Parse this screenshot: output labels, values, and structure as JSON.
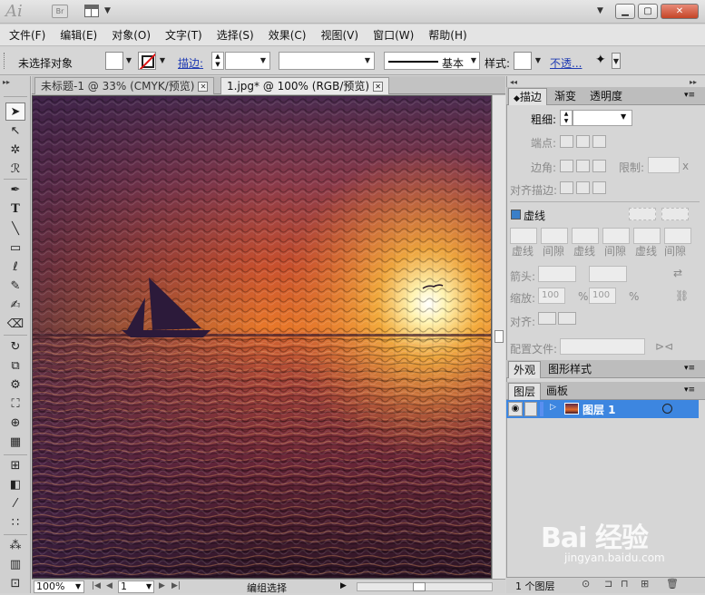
{
  "titlebar": {
    "app_logo": "Ai",
    "bridge_logo": "Br",
    "arrange_dropdown": "▼",
    "window_menu_arrow": "▼",
    "minimize": "▁",
    "restore": "▢",
    "close": "✕"
  },
  "menu": [
    {
      "label": "文件(F)"
    },
    {
      "label": "编辑(E)"
    },
    {
      "label": "对象(O)"
    },
    {
      "label": "文字(T)"
    },
    {
      "label": "选择(S)"
    },
    {
      "label": "效果(C)"
    },
    {
      "label": "视图(V)"
    },
    {
      "label": "窗口(W)"
    },
    {
      "label": "帮助(H)"
    }
  ],
  "controlbar": {
    "selection_status": "未选择对象",
    "stroke_label": "描边:",
    "stroke_profile": "基本",
    "style_label": "样式:",
    "opacity_label": "不透..."
  },
  "tabs": [
    {
      "label": "未标题-1 @ 33% (CMYK/预览)",
      "active": false
    },
    {
      "label": "1.jpg* @ 100% (RGB/预览)",
      "active": true
    }
  ],
  "statusbar": {
    "zoom": "100%",
    "artboard": "1",
    "mode": "编组选择"
  },
  "stroke_panel": {
    "tabs": [
      "描边",
      "渐变",
      "透明度"
    ],
    "weight_label": "粗细:",
    "cap_label": "端点:",
    "corner_label": "边角:",
    "limit_label": "限制:",
    "limit_unit": "x",
    "align_label": "对齐描边:",
    "dashed_label": "虚线",
    "dash_fields": [
      "虚线",
      "间隙",
      "虚线",
      "间隙",
      "虚线",
      "间隙"
    ],
    "arrow_label": "箭头:",
    "scale_label": "缩放:",
    "scale_1": "100",
    "scale_2": "100",
    "percent": "%",
    "align_arrow_label": "对齐:",
    "profile_label": "配置文件:"
  },
  "appearance_panel": {
    "tabs": [
      "外观",
      "图形样式"
    ]
  },
  "layers_panel": {
    "tabs": [
      "图层",
      "画板"
    ],
    "layer_name": "图层 1",
    "footer_count": "1 个图层"
  },
  "watermark": {
    "brand": "Bai 经验",
    "url": "jingyan.baidu.com"
  }
}
